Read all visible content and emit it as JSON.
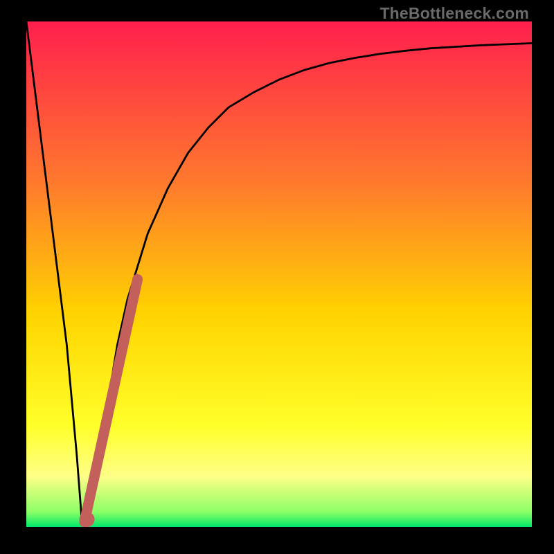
{
  "watermark": "TheBottleneck.com",
  "colors": {
    "frame": "#000000",
    "gradient_top": "#ff1f4d",
    "gradient_mid1": "#ff7a2d",
    "gradient_mid2": "#ffd400",
    "gradient_mid3": "#ffff2a",
    "gradient_band": "#ffff88",
    "gradient_bottom": "#00e868",
    "curve": "#000000",
    "marker": "#c4605b"
  },
  "chart_data": {
    "type": "line",
    "title": "",
    "xlabel": "",
    "ylabel": "",
    "xlim": [
      0,
      100
    ],
    "ylim": [
      0,
      100
    ],
    "series": [
      {
        "name": "bottleneck-curve",
        "x": [
          0,
          2,
          4,
          6,
          8,
          10,
          11,
          12,
          14,
          16,
          18,
          20,
          24,
          28,
          32,
          36,
          40,
          45,
          50,
          55,
          60,
          65,
          70,
          75,
          80,
          85,
          90,
          95,
          100
        ],
        "values": [
          100,
          84,
          68,
          52,
          36,
          14,
          1,
          1,
          12,
          24,
          36,
          45,
          58,
          67,
          74,
          79,
          83,
          86,
          88.5,
          90.4,
          91.8,
          92.8,
          93.6,
          94.2,
          94.7,
          95,
          95.3,
          95.5,
          95.7
        ]
      }
    ],
    "marker_segment": {
      "name": "highlight",
      "start": {
        "x": 11.5,
        "y": 1
      },
      "end": {
        "x": 22,
        "y": 49
      }
    },
    "marker_dot": {
      "x": 12,
      "y": 1.5
    }
  }
}
